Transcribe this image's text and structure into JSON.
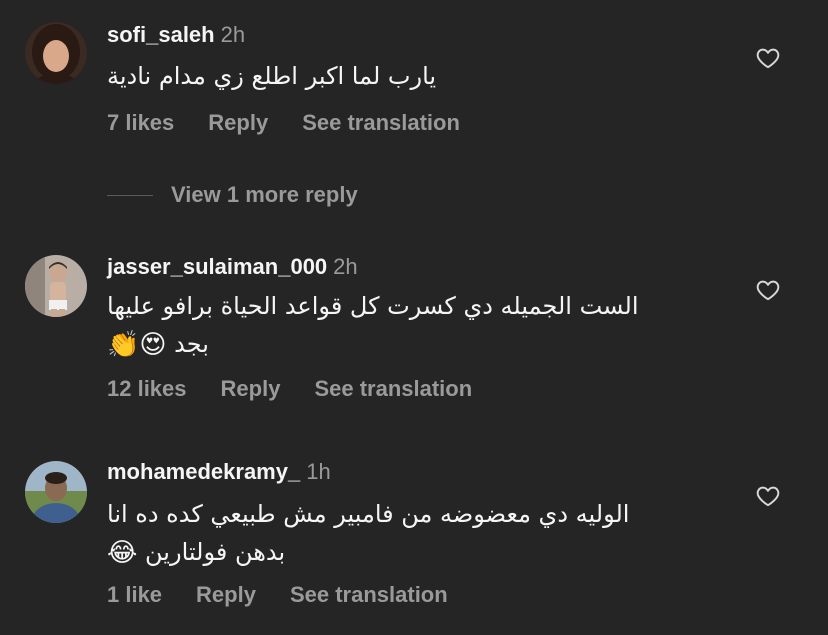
{
  "comments": [
    {
      "username": "sofi_saleh",
      "time": "2h",
      "lines": [
        "يارب لما اكبر اطلع زي مدام نادية"
      ],
      "emoji": "",
      "likes": "7 likes",
      "reply": "Reply",
      "translate": "See translation",
      "avatar_colors": {
        "bg": "#3a2a22",
        "face": "#d9a78a",
        "hair": "#2a1a14"
      }
    },
    {
      "username": "jasser_sulaiman_000",
      "time": "2h",
      "lines": [
        "الست الجميله دي كسرت كل قواعد الحياة برافو عليها",
        "بجد"
      ],
      "emoji": "😍👏",
      "likes": "12 likes",
      "reply": "Reply",
      "translate": "See translation",
      "avatar_colors": {
        "bg": "#b8aea6",
        "face": "#c9a892",
        "hair": "#3b2f28"
      }
    },
    {
      "username": "mohamedekramy_",
      "time": "1h",
      "lines": [
        "الوليه دي معضوضه من فامبير مش طبيعي كده ده انا",
        "بدهن فولتارين"
      ],
      "emoji": "😂",
      "likes": "1 like",
      "reply": "Reply",
      "translate": "See translation",
      "avatar_colors": {
        "bg": "#6f8a4a",
        "face": "#8a6a52",
        "shirt": "#3f5f8f"
      }
    }
  ],
  "view_more": "View 1 more reply",
  "colors": {
    "background": "#252525",
    "text": "#f5f5f5",
    "muted": "#9a9a9a"
  },
  "icons": {
    "like": "heart-outline-icon"
  }
}
